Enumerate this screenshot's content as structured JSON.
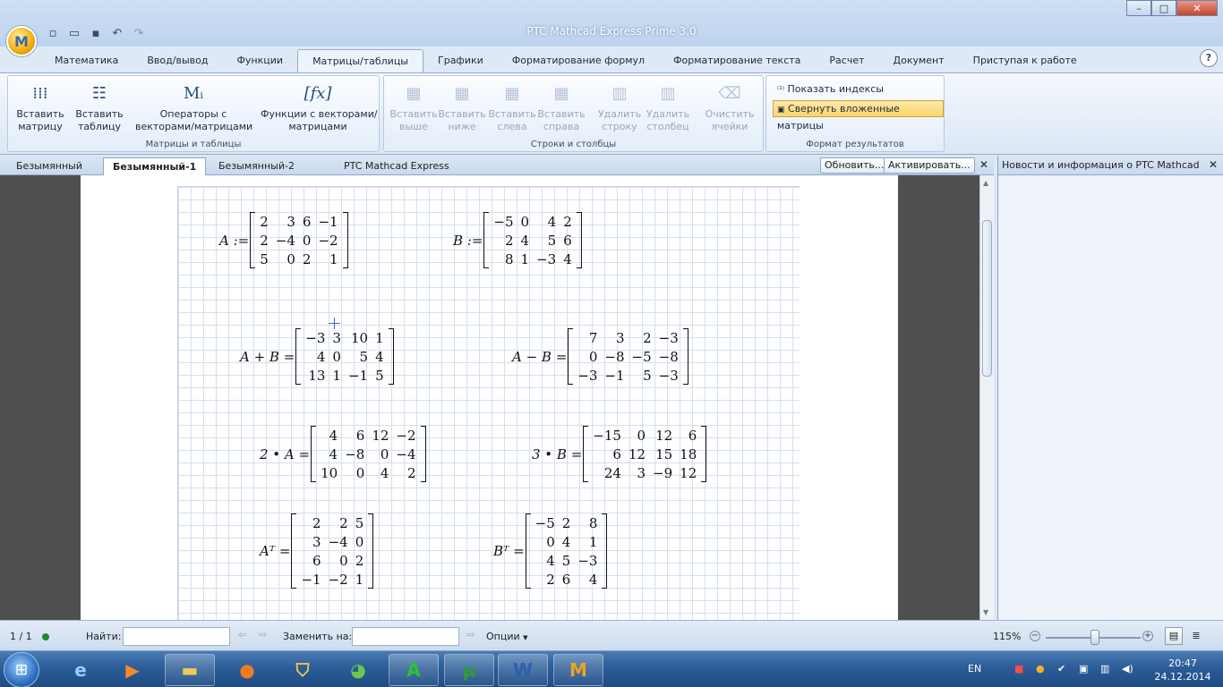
{
  "app": {
    "title": "PTC Mathcad Express Prime 3.0",
    "logo_letter": "M"
  },
  "window_buttons": {
    "minimize": "–",
    "maximize": "□",
    "close": "✕"
  },
  "quick_access": [
    "new-doc-icon",
    "open-folder-icon",
    "save-icon",
    "undo-icon",
    "redo-icon"
  ],
  "ribbon_tabs": [
    "Математика",
    "Ввод/вывод",
    "Функции",
    "Матрицы/таблицы",
    "Графики",
    "Форматирование формул",
    "Форматирование текста",
    "Расчет",
    "Документ",
    "Приступая к работе"
  ],
  "active_tab": "Матрицы/таблицы",
  "help": "?",
  "ribbon": {
    "group1": {
      "label": "Матрицы и таблицы",
      "insert_matrix": "Вставить\nматрицу",
      "insert_table": "Вставить\nтаблицу",
      "operators": "Операторы с\nвекторами/матрицами",
      "functions": "Функции с векторами/\nматрицами",
      "operators_icon": "Mᵢ",
      "functions_icon": "[fx]"
    },
    "group2": {
      "label": "Строки и столбцы",
      "insert_above": "Вставить\nвыше",
      "insert_below": "Вставить\nниже",
      "insert_left": "Вставить\nслева",
      "insert_right": "Вставить\nсправа",
      "delete_row": "Удалить\nстроку",
      "delete_column": "Удалить\nстолбец",
      "clear_cells": "Очистить\nячейки"
    },
    "group3": {
      "label": "Формат результатов",
      "show_indices": "Показать индексы",
      "collapse_nested": "Свернуть вложенные матрицы"
    }
  },
  "doc_tabs": [
    "Безымянный",
    "Безымянный-1",
    "Безымянный-2"
  ],
  "active_doc": "Безымянный-1",
  "doc_title": "PTC Mathcad Express",
  "update_button": "Обновить...",
  "activate_button": "Активировать...",
  "side_panel": {
    "title": "Новости и информация о PTC Mathcad"
  },
  "worksheet": {
    "A_def": {
      "lhs": "A :=",
      "rows": [
        [
          "2",
          "3",
          "6",
          "−1"
        ],
        [
          "2",
          "−4",
          "0",
          "−2"
        ],
        [
          "5",
          "0",
          "2",
          "1"
        ]
      ]
    },
    "B_def": {
      "lhs": "B :=",
      "rows": [
        [
          "−5",
          "0",
          "4",
          "2"
        ],
        [
          "2",
          "4",
          "5",
          "6"
        ],
        [
          "8",
          "1",
          "−3",
          "4"
        ]
      ]
    },
    "sum": {
      "lhs": "A + B =",
      "rows": [
        [
          "−3",
          "3",
          "10",
          "1"
        ],
        [
          "4",
          "0",
          "5",
          "4"
        ],
        [
          "13",
          "1",
          "−1",
          "5"
        ]
      ]
    },
    "diff": {
      "lhs": "A − B =",
      "rows": [
        [
          "7",
          "3",
          "2",
          "−3"
        ],
        [
          "0",
          "−8",
          "−5",
          "−8"
        ],
        [
          "−3",
          "−1",
          "5",
          "−3"
        ]
      ]
    },
    "twoA": {
      "lhs": "2 • A =",
      "rows": [
        [
          "4",
          "6",
          "12",
          "−2"
        ],
        [
          "4",
          "−8",
          "0",
          "−4"
        ],
        [
          "10",
          "0",
          "4",
          "2"
        ]
      ]
    },
    "threeB": {
      "lhs": "3 • B =",
      "rows": [
        [
          "−15",
          "0",
          "12",
          "6"
        ],
        [
          "6",
          "12",
          "15",
          "18"
        ],
        [
          "24",
          "3",
          "−9",
          "12"
        ]
      ]
    },
    "AT": {
      "lhs": "Aᵀ =",
      "rows": [
        [
          "2",
          "2",
          "5"
        ],
        [
          "3",
          "−4",
          "0"
        ],
        [
          "6",
          "0",
          "2"
        ],
        [
          "−1",
          "−2",
          "1"
        ]
      ]
    },
    "BT": {
      "lhs": "Bᵀ =",
      "rows": [
        [
          "−5",
          "2",
          "8"
        ],
        [
          "0",
          "4",
          "1"
        ],
        [
          "4",
          "5",
          "−3"
        ],
        [
          "2",
          "6",
          "4"
        ]
      ]
    }
  },
  "status": {
    "page": "1 / 1",
    "find_label": "Найти:",
    "find_value": "",
    "replace_label": "Заменить на:",
    "replace_value": "",
    "options": "Опции",
    "zoom": "115%",
    "zoom_level_percent": 115
  },
  "taskbar": {
    "lang": "EN",
    "time": "20:47",
    "date": "24.12.2014",
    "apps": [
      "internet-explorer-icon",
      "media-player-icon",
      "explorer-folder-icon",
      "firefox-icon",
      "shield-app-icon",
      "chrome-like-icon",
      "a-app-icon",
      "utorrent-icon",
      "word-icon",
      "mathcad-icon"
    ]
  }
}
